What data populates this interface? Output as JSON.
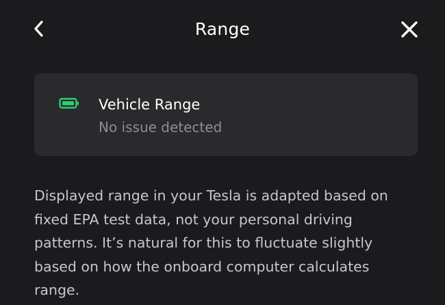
{
  "header": {
    "title": "Range",
    "back_icon": "chevron-left-icon",
    "close_icon": "close-icon"
  },
  "card": {
    "icon": "battery-icon",
    "icon_color": "#2ecc71",
    "title": "Vehicle Range",
    "status": "No issue detected"
  },
  "description": "Displayed range in your Tesla is adapted based on fixed EPA test data, not your personal driving patterns. It’s natural for this to fluctuate slightly based on how the onboard computer calculates range.",
  "colors": {
    "background": "#1b1b1d",
    "card_background": "#2a2a2c",
    "text_primary": "#ffffff",
    "text_secondary": "#8e8e93",
    "text_body": "#c7c7cc"
  }
}
